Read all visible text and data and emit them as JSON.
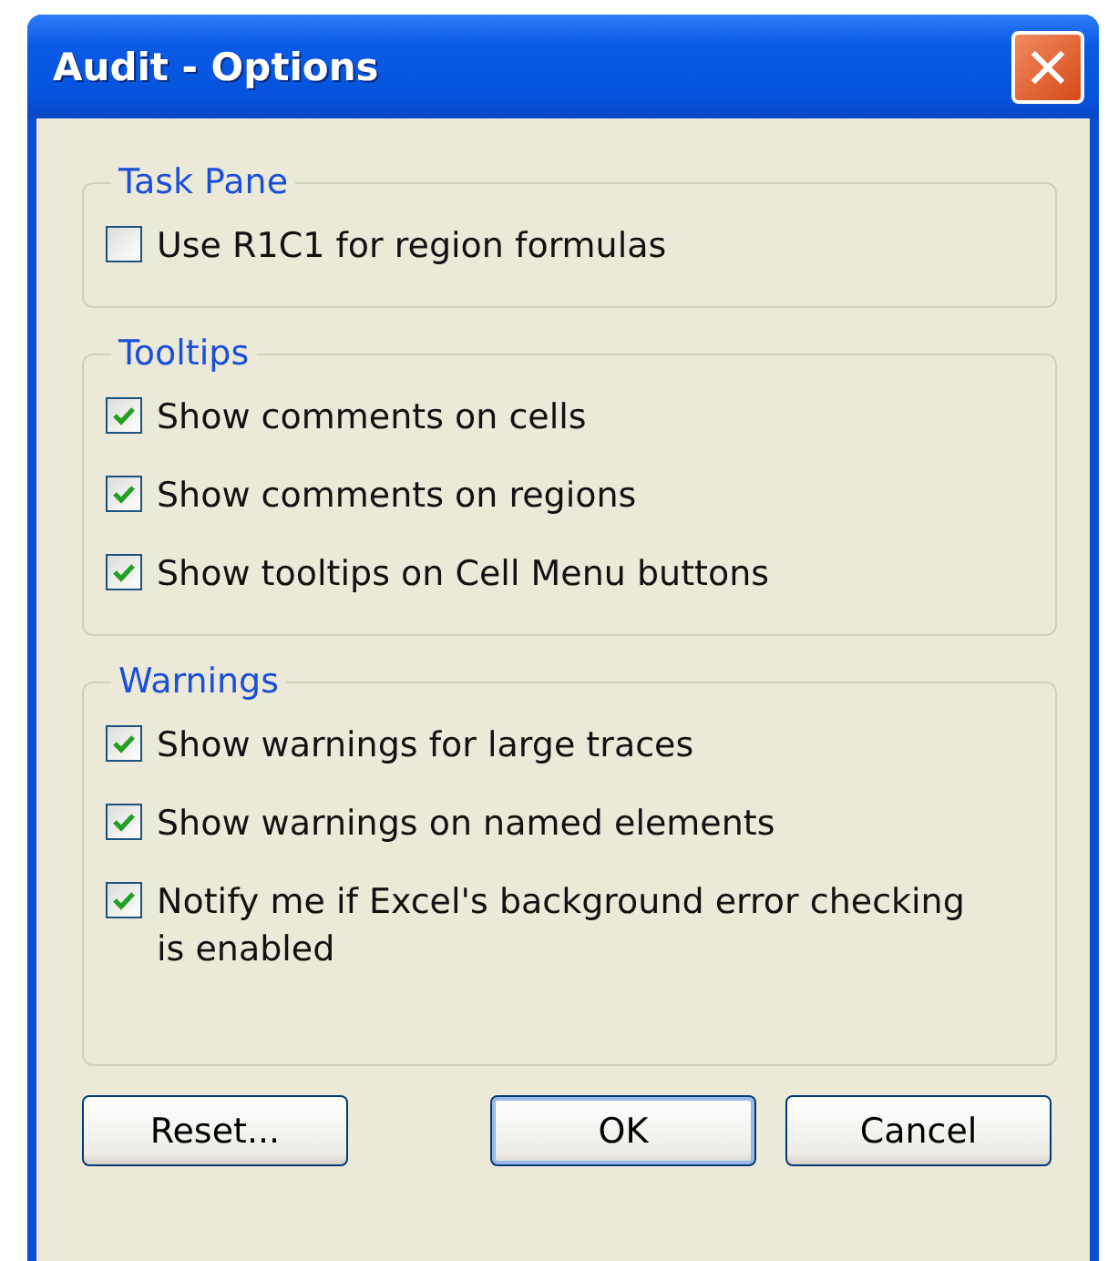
{
  "window": {
    "title": "Audit - Options"
  },
  "groups": [
    {
      "title": "Task Pane",
      "options": [
        {
          "label": "Use R1C1 for region formulas",
          "checked": false
        }
      ]
    },
    {
      "title": "Tooltips",
      "options": [
        {
          "label": "Show comments on cells",
          "checked": true
        },
        {
          "label": "Show comments on regions",
          "checked": true
        },
        {
          "label": "Show tooltips on Cell Menu buttons",
          "checked": true
        }
      ]
    },
    {
      "title": "Warnings",
      "options": [
        {
          "label": "Show warnings for large traces",
          "checked": true
        },
        {
          "label": "Show warnings on named elements",
          "checked": true
        },
        {
          "label": "Notify me if Excel's background error checking is enabled",
          "checked": true
        }
      ]
    }
  ],
  "buttons": [
    {
      "label": "Reset...",
      "default": false
    },
    {
      "label": "OK",
      "default": true
    },
    {
      "label": "Cancel",
      "default": false
    }
  ]
}
